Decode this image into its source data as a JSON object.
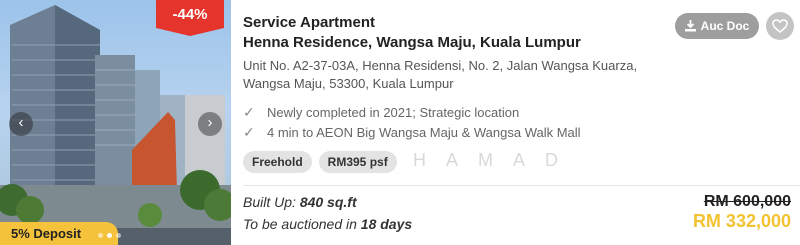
{
  "listing": {
    "discount_badge": "-44%",
    "deposit_badge": "5% Deposit",
    "property_type": "Service Apartment",
    "property_name": "Henna Residence, Wangsa Maju, Kuala Lumpur",
    "address": "Unit No. A2-37-03A, Henna Residensi, No. 2, Jalan Wangsa Kuarza, Wangsa Maju, 53300, Kuala Lumpur",
    "features": [
      "Newly completed in 2021; Strategic location",
      "4 min to AEON Big Wangsa Maju & Wangsa Walk Mall"
    ],
    "tags": [
      "Freehold",
      "RM395 psf"
    ],
    "watermark": "HAMAD",
    "built_up_label": "Built Up: ",
    "built_up_value": "840 sq.ft",
    "auction_label": "To be auctioned in ",
    "auction_value": "18 days",
    "original_price": "RM 600,000",
    "auction_price": "RM 332,000"
  },
  "actions": {
    "auc_doc_label": "Auc Doc"
  },
  "icons": {
    "download": "download-icon",
    "favorite": "heart-icon",
    "prev": "chevron-left-icon",
    "next": "chevron-right-icon",
    "check": "check-icon"
  },
  "colors": {
    "discount_red": "#e5342c",
    "deposit_yellow": "#f5c33b",
    "auction_price": "#f2c231",
    "button_grey": "#9e9e9e"
  },
  "carousel": {
    "slide_count": 3,
    "active_slide": 1
  }
}
